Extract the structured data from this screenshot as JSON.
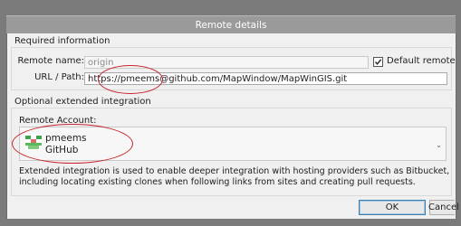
{
  "window": {
    "title": "Remote details"
  },
  "required": {
    "title": "Required information",
    "remote_name_label": "Remote name:",
    "remote_name_value": "origin",
    "default_remote_label": "Default remote",
    "default_remote_checked": true,
    "url_label": "URL / Path:",
    "url_value": "https://pmeems@github.com/MapWindow/MapWinGIS.git"
  },
  "optional": {
    "title": "Optional extended integration",
    "remote_account_label": "Remote Account:",
    "account_name": "pmeems",
    "account_host": "GitHub",
    "description_line1": "Extended integration is used to enable deeper integration with hosting providers such as Bitbucket,",
    "description_line2": "including locating existing clones when following links from sites and creating pull requests."
  },
  "buttons": {
    "ok": "OK",
    "cancel": "Cancel"
  },
  "icons": {
    "checkbox": "checkmark-icon",
    "dropdown": "chevron-down-icon",
    "avatar": "github-identicon-icon"
  },
  "colors": {
    "annotation_red": "#c8232c",
    "window_frame": "#7b7b7b",
    "dialog_bg": "#f0f0f0",
    "default_button_border": "#3c7fb1"
  }
}
